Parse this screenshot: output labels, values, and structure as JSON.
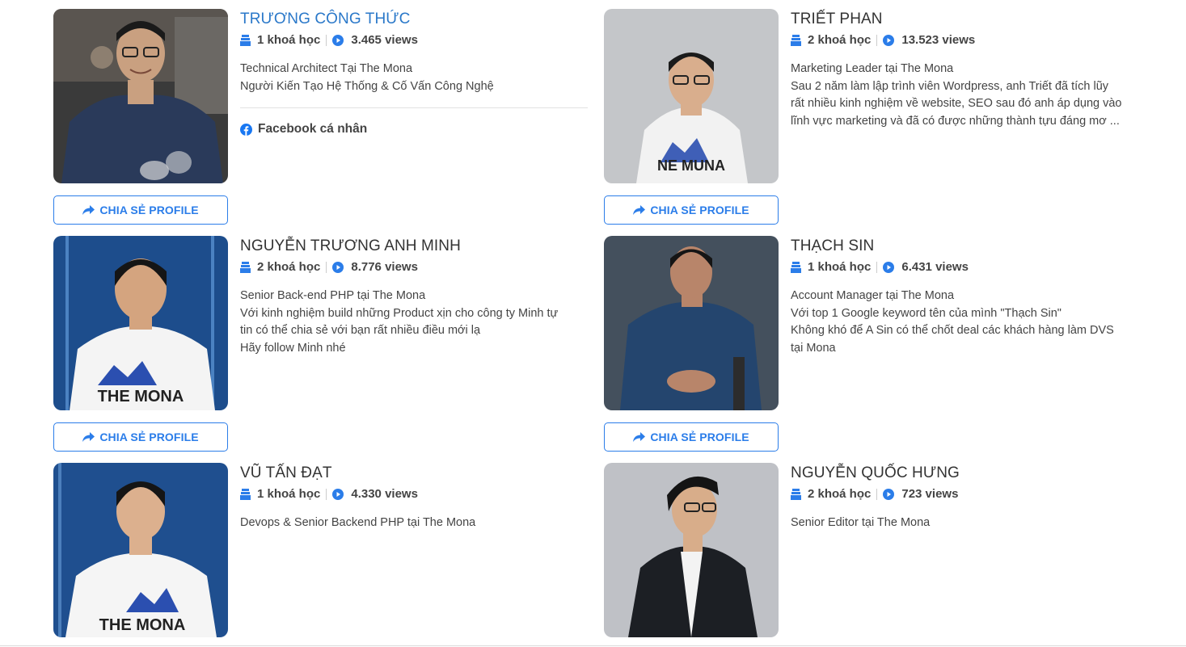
{
  "share_label": "CHIA SẺ PROFILE",
  "accent_color": "#2b7de9",
  "profiles": [
    {
      "name": "TRƯƠNG CÔNG THỨC",
      "courses": "1 khoá học",
      "views": "3.465 views",
      "desc": [
        "Technical Architect Tại The Mona",
        "Người Kiến Tạo Hệ Thống & Cố Vấn Công Nghệ"
      ],
      "facebook": "Facebook cá nhân"
    },
    {
      "name": "TRIẾT PHAN",
      "courses": "2 khoá học",
      "views": "13.523 views",
      "desc": [
        "Marketing Leader tại The Mona",
        "Sau 2 năm làm lập trình viên Wordpress, anh Triết đã tích lũy",
        "rất nhiều kinh nghiệm về website, SEO sau đó anh áp dụng vào",
        "lĩnh vực marketing và đã có được những thành tựu đáng mơ ..."
      ]
    },
    {
      "name": "NGUYỄN TRƯƠNG ANH MINH",
      "courses": "2 khoá học",
      "views": "8.776 views",
      "desc": [
        "Senior Back-end PHP tại The Mona",
        "Với kinh nghiệm build những Product xịn cho công ty Minh tự",
        "tin có thể chia sẻ với bạn rất nhiều điều mới lạ",
        "Hãy follow Minh nhé"
      ]
    },
    {
      "name": "THẠCH SIN",
      "courses": "1 khoá học",
      "views": "6.431 views",
      "desc": [
        "Account Manager tại The Mona",
        "Với top 1 Google keyword tên của mình \"Thạch Sin\"",
        "Không khó để A Sin có thể chốt deal các khách hàng làm DVS",
        "tại Mona"
      ]
    },
    {
      "name": "VŨ TẤN ĐẠT",
      "courses": "1 khoá học",
      "views": "4.330 views",
      "desc": [
        "Devops & Senior Backend PHP tại The Mona"
      ]
    },
    {
      "name": "NGUYỄN QUỐC HƯNG",
      "courses": "2 khoá học",
      "views": "723 views",
      "desc": [
        "Senior Editor tại The Mona"
      ]
    }
  ]
}
